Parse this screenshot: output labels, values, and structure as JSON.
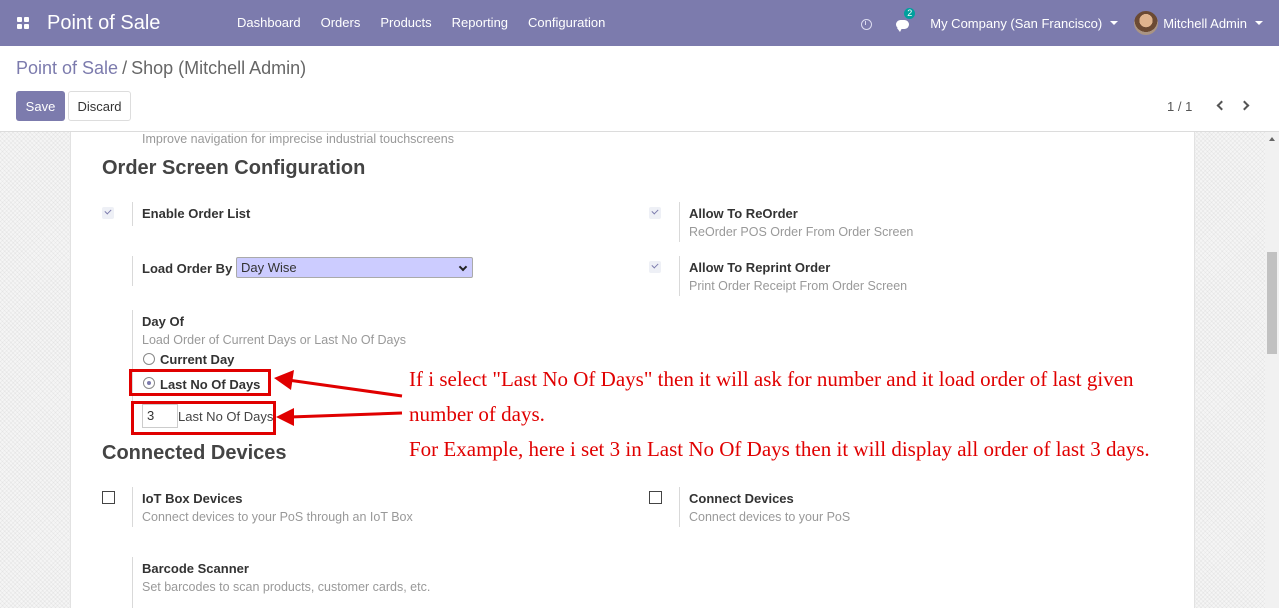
{
  "navbar": {
    "app_title": "Point of Sale",
    "menu": [
      "Dashboard",
      "Orders",
      "Products",
      "Reporting",
      "Configuration"
    ],
    "chat_count": "2",
    "company": "My Company (San Francisco)",
    "user": "Mitchell Admin",
    "brand_color": "#7c7bad"
  },
  "control_panel": {
    "breadcrumb_root": "Point of Sale",
    "breadcrumb_sep": "/",
    "breadcrumb_current": "Shop (Mitchell Admin)",
    "save_label": "Save",
    "discard_label": "Discard",
    "pager": "1 / 1"
  },
  "settings": {
    "prev_help": "Improve navigation for imprecise industrial touchscreens",
    "order_section_title": "Order Screen Configuration",
    "enable_order_list": {
      "label": "Enable Order List",
      "checked": true
    },
    "allow_reorder": {
      "label": "Allow To ReOrder",
      "help": "ReOrder POS Order From Order Screen",
      "checked": true
    },
    "load_order_by": {
      "label": "Load Order By",
      "value": "Day Wise"
    },
    "allow_reprint": {
      "label": "Allow To Reprint Order",
      "help": "Print Order Receipt From Order Screen",
      "checked": true
    },
    "day_of": {
      "label": "Day Of",
      "help": "Load Order of Current Days or Last No Of Days",
      "options": [
        "Current Day",
        "Last No Of Days"
      ],
      "selected": "Last No Of Days"
    },
    "last_days": {
      "value": "3",
      "label": "Last No Of Days"
    },
    "devices_section_title": "Connected Devices",
    "iot_box": {
      "label": "IoT Box Devices",
      "help": "Connect devices to your PoS through an IoT Box",
      "checked": false
    },
    "connect_devices": {
      "label": "Connect Devices",
      "help": "Connect devices to your PoS",
      "checked": false
    },
    "barcode": {
      "label": "Barcode Scanner",
      "help": "Set barcodes to scan products, customer cards, etc."
    }
  },
  "annotation": {
    "line1": "If i select \"Last No Of Days\" then it will ask for number and it load order of last given",
    "line2": "number of days.",
    "line3": "For  Example, here i set 3 in Last No Of Days then it will display all order of last 3 days.",
    "color": "#e00000"
  }
}
